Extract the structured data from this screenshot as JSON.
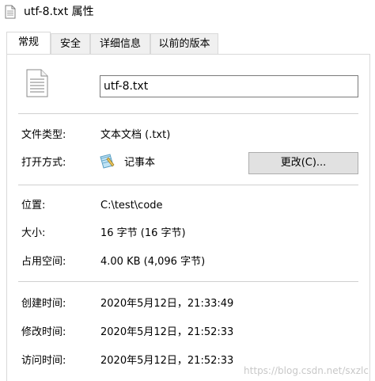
{
  "window": {
    "title": "utf-8.txt 属性"
  },
  "tabs": [
    {
      "label": "常规",
      "active": true
    },
    {
      "label": "安全",
      "active": false
    },
    {
      "label": "详细信息",
      "active": false
    },
    {
      "label": "以前的版本",
      "active": false
    }
  ],
  "general": {
    "file_icon": "text-file-icon",
    "filename": "utf-8.txt",
    "file_type_label": "文件类型:",
    "file_type_value": "文本文档 (.txt)",
    "open_with_label": "打开方式:",
    "open_with_app_icon": "notepad-icon",
    "open_with_value": "记事本",
    "change_button": "更改(C)...",
    "location_label": "位置:",
    "location_value": "C:\\test\\code",
    "size_label": "大小:",
    "size_value": "16 字节 (16 字节)",
    "disk_size_label": "占用空间:",
    "disk_size_value": "4.00 KB (4,096 字节)",
    "created_label": "创建时间:",
    "created_value": "2020年5月12日，21:33:49",
    "modified_label": "修改时间:",
    "modified_value": "2020年5月12日，21:52:33",
    "accessed_label": "访问时间:",
    "accessed_value": "2020年5月12日，21:52:33"
  },
  "watermark": "https://blog.csdn.net/sxzlc",
  "colors": {
    "button_bg": "#e1e1e1",
    "tab_inactive_bg": "#f0f0f0",
    "border": "#d9d9d9"
  }
}
